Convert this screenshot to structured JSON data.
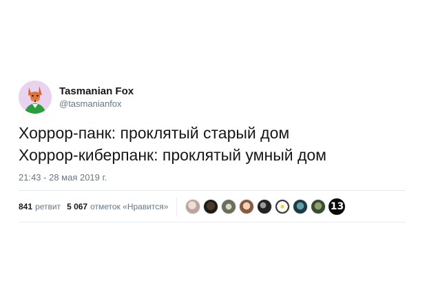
{
  "tweet": {
    "display_name": "Tasmanian Fox",
    "handle": "@tasmanianfox",
    "text_lines": [
      "Хоррор-панк: проклятый старый дом",
      "Хоррор-киберпанк: проклятый умный дом"
    ],
    "timestamp": "21:43 - 28 мая 2019 г.",
    "retweets": {
      "count": "841",
      "label": "ретвит"
    },
    "likes": {
      "count": "5 067",
      "label": "отметок «Нравится»"
    },
    "liker_count": "13",
    "colors": {
      "avatar_bg": "#e9d3ef",
      "text": "#14171a",
      "secondary": "#657786",
      "divider": "#e6ecf0"
    }
  }
}
